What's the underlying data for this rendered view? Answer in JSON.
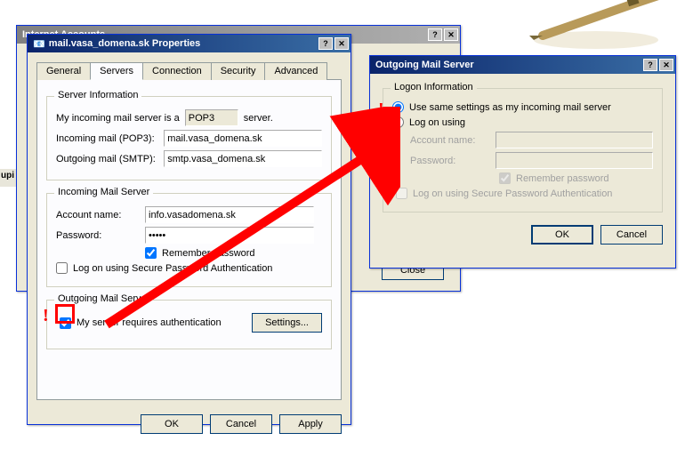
{
  "bg_accounts_title": "Internet Accounts",
  "bg_close_btn": "Close",
  "bg_side_text": "upi",
  "props": {
    "title": "mail.vasa_domena.sk Properties",
    "tabs": [
      "General",
      "Servers",
      "Connection",
      "Security",
      "Advanced"
    ],
    "active_tab": 1,
    "server_info_legend": "Server Information",
    "incoming_label": "My incoming mail server is a",
    "incoming_type": "POP3",
    "incoming_suffix": "server.",
    "pop3_label": "Incoming mail (POP3):",
    "pop3_value": "mail.vasa_domena.sk",
    "smtp_label": "Outgoing mail (SMTP):",
    "smtp_value": "smtp.vasa_domena.sk",
    "ims_legend": "Incoming Mail Server",
    "acct_label": "Account name:",
    "acct_value": "info.vasadomena.sk",
    "pwd_label": "Password:",
    "pwd_value": "•••••",
    "remember_label": "Remember password",
    "spa_label": "Log on using Secure Password Authentication",
    "oms_legend": "Outgoing Mail Server",
    "reqauth_label": "My server requires authentication",
    "settings_btn": "Settings...",
    "ok": "OK",
    "cancel": "Cancel",
    "apply": "Apply"
  },
  "outgoing": {
    "title": "Outgoing Mail Server",
    "legend": "Logon Information",
    "opt_same": "Use same settings as my incoming mail server",
    "opt_logon": "Log on using",
    "acct_label": "Account name:",
    "pwd_label": "Password:",
    "remember_label": "Remember password",
    "spa_label": "Log on using Secure Password Authentication",
    "ok": "OK",
    "cancel": "Cancel"
  }
}
